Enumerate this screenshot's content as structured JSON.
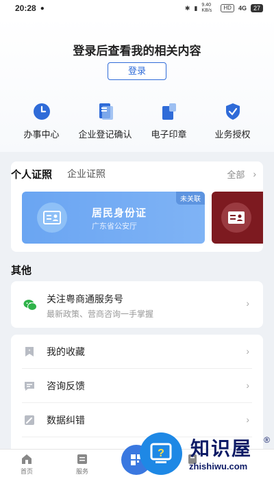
{
  "status_bar": {
    "time": "20:28",
    "network": "9.40 KB/s",
    "hd": "HD",
    "signal": "4G",
    "battery": "27"
  },
  "header": {
    "title": "登录后查看我的相关内容",
    "login_label": "登录"
  },
  "quick_actions": [
    {
      "label": "办事中心",
      "icon": "clock-icon"
    },
    {
      "label": "企业登记确认",
      "icon": "document-icon"
    },
    {
      "label": "电子印章",
      "icon": "seal-icon"
    },
    {
      "label": "业务授权",
      "icon": "shield-check-icon"
    }
  ],
  "certificates": {
    "tab_personal": "个人证照",
    "tab_enterprise": "企业证照",
    "all_label": "全部",
    "id_card": {
      "badge": "未关联",
      "title": "居民身份证",
      "issuer": "广东省公安厅"
    }
  },
  "other_section": {
    "title": "其他",
    "follow": {
      "title": "关注粤商通服务号",
      "subtitle": "最新政策、营商咨询一手掌握"
    },
    "items": [
      {
        "label": "我的收藏",
        "icon": "bookmark-icon"
      },
      {
        "label": "咨询反馈",
        "icon": "chat-icon"
      },
      {
        "label": "数据纠错",
        "icon": "edit-icon"
      }
    ]
  },
  "bottom_nav": {
    "home": "首页",
    "service": "服务"
  },
  "watermark": {
    "text": "知识屋",
    "url": "zhishiwu.com",
    "mark": "®"
  },
  "colors": {
    "accent": "#2f6bd8",
    "id_card": "#6aa5f2",
    "license_card": "#7d1a20"
  }
}
